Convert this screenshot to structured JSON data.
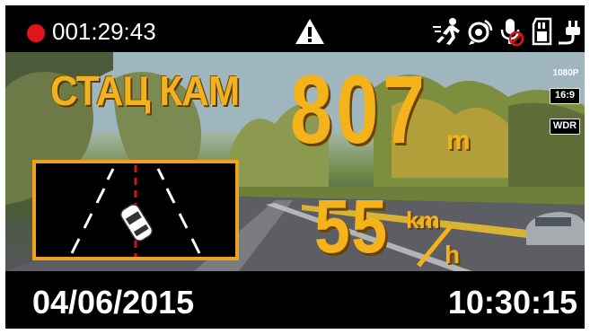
{
  "recording": {
    "indicator_icon": "record-dot-icon",
    "indicator_color": "#e0141c",
    "elapsed_time": "001:29:43"
  },
  "status_icons": [
    "warning-triangle-icon",
    "motion-detection-icon",
    "gps-signal-icon",
    "microphone-muted-icon",
    "memory-card-icon",
    "power-plug-icon"
  ],
  "alert": {
    "label": "СТАЦ КАМ",
    "icon": "speed-camera-ring-icon",
    "distance_value": "807",
    "distance_unit": "m",
    "speed_value": "55",
    "speed_unit_top": "km",
    "speed_unit_bottom": "h",
    "accent_color": "#f4b21b"
  },
  "lane_monitor": {
    "icon": "lane-departure-car-icon",
    "border_color": "#f0a21c"
  },
  "video_badges": {
    "resolution": "1080P",
    "aspect_ratio": "16:9",
    "wdr": "WDR"
  },
  "footer": {
    "date": "04/06/2015",
    "time": "10:30:15"
  }
}
